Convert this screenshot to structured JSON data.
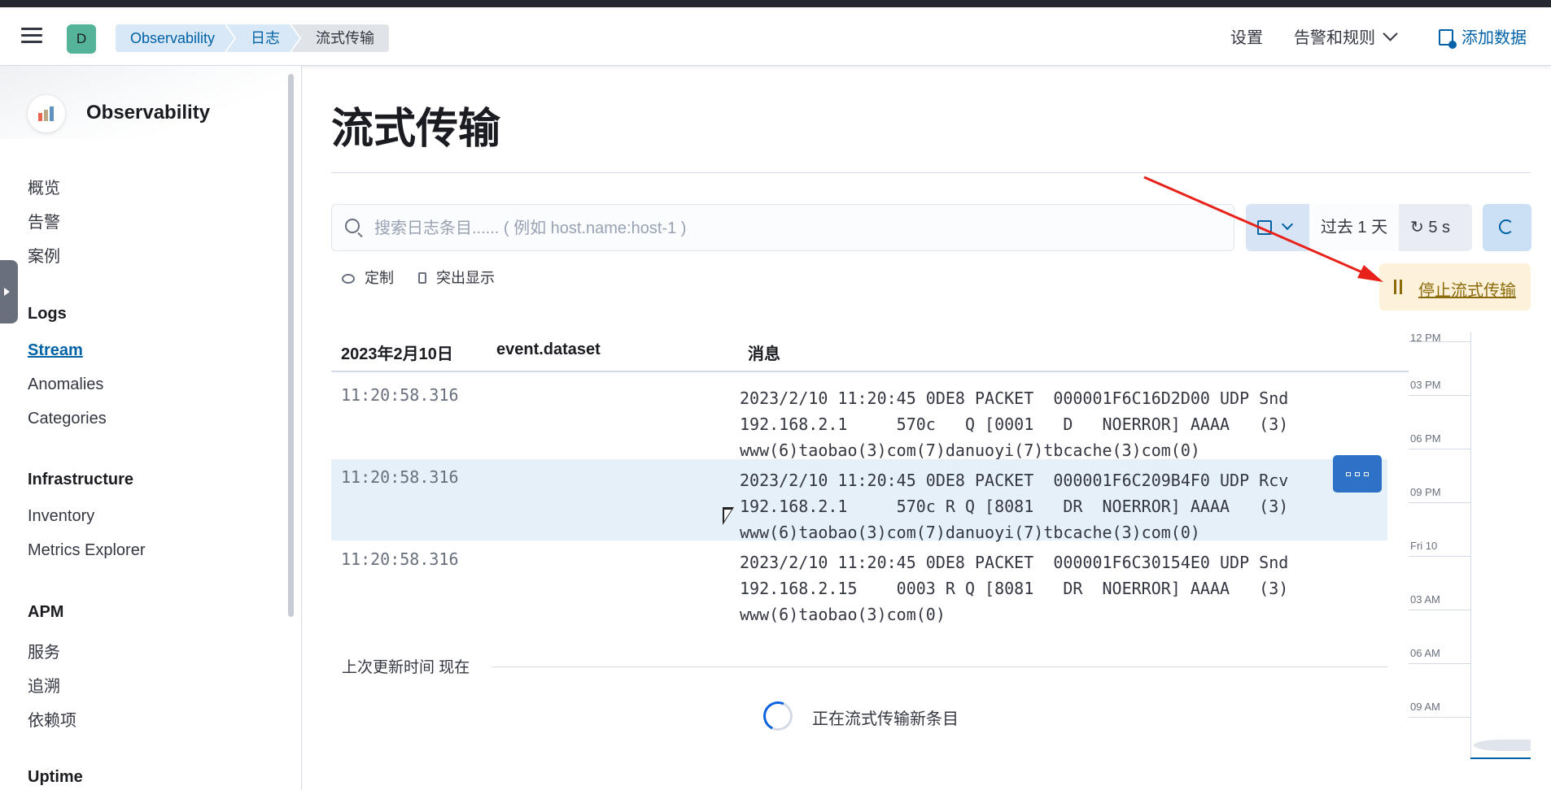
{
  "header": {
    "avatar_initial": "D",
    "breadcrumbs": [
      "Observability",
      "日志",
      "流式传输"
    ],
    "settings": "设置",
    "alerts_rules": "告警和规则",
    "add_data": "添加数据"
  },
  "sidebar": {
    "app_title": "Observability",
    "top_items": [
      "概览",
      "告警",
      "案例"
    ],
    "logs": {
      "heading": "Logs",
      "items": [
        "Stream",
        "Anomalies",
        "Categories"
      ],
      "active": "Stream"
    },
    "infrastructure": {
      "heading": "Infrastructure",
      "items": [
        "Inventory",
        "Metrics Explorer"
      ]
    },
    "apm": {
      "heading": "APM",
      "items": [
        "服务",
        "追溯",
        "依赖项"
      ]
    },
    "uptime": {
      "heading": "Uptime"
    }
  },
  "main": {
    "title": "流式传输",
    "search_placeholder": "搜索日志条目...... ( 例如 host.name:host-1 )",
    "time_range": "过去 1 天",
    "refresh_interval": "5 s",
    "customize": "定制",
    "highlight": "突出显示",
    "stop_streaming": "停止流式传输",
    "columns": [
      "2023年2月10日",
      "event.dataset",
      "消息"
    ],
    "rows": [
      {
        "time": "11:20:58.316",
        "dataset": "",
        "message": "2023/2/10 11:20:45 0DE8 PACKET  000001F6C16D2D00 UDP Snd\n192.168.2.1     570c   Q [0001   D   NOERROR] AAAA   (3)\nwww(6)taobao(3)com(7)danuoyi(7)tbcache(3)com(0)"
      },
      {
        "time": "11:20:58.316",
        "dataset": "",
        "message": "2023/2/10 11:20:45 0DE8 PACKET  000001F6C209B4F0 UDP Rcv\n192.168.2.1     570c R Q [8081   DR  NOERROR] AAAA   (3)\nwww(6)taobao(3)com(7)danuoyi(7)tbcache(3)com(0)"
      },
      {
        "time": "11:20:58.316",
        "dataset": "",
        "message": "2023/2/10 11:20:45 0DE8 PACKET  000001F6C30154E0 UDP Snd\n192.168.2.15    0003 R Q [8081   DR  NOERROR] AAAA   (3)\nwww(6)taobao(3)com(0)"
      }
    ],
    "last_updated": "上次更新时间 现在",
    "streaming_status": "正在流式传输新条目"
  },
  "minimap": {
    "labels": [
      "12 PM",
      "03 PM",
      "06 PM",
      "09 PM",
      "Fri 10",
      "03 AM",
      "06 AM",
      "09 AM"
    ]
  },
  "colors": {
    "accent": "#0061a6",
    "annotation_arrow": "#e8221b",
    "stop_bg": "#fdf2d9"
  }
}
